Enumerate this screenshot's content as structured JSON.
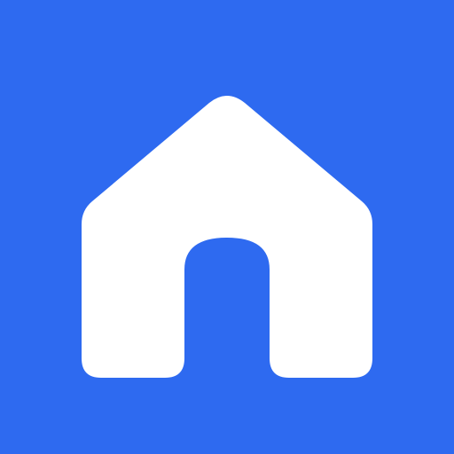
{
  "icon": {
    "name": "home-icon",
    "background_color": "#2e6af0",
    "glyph_color": "#ffffff"
  }
}
